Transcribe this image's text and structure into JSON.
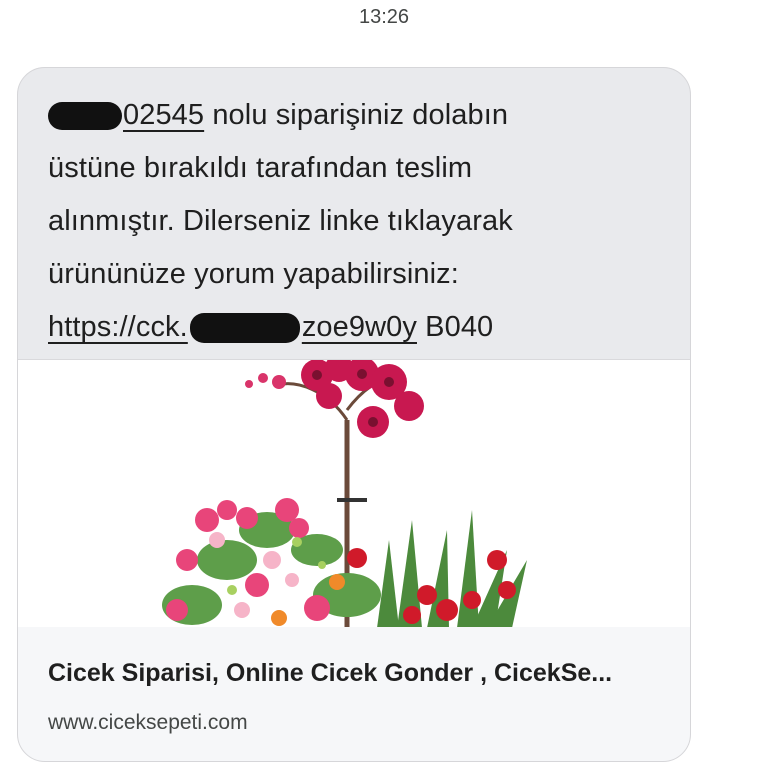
{
  "status": {
    "time": "13:26"
  },
  "message": {
    "line1_number_visible": "02545",
    "line1_rest": " nolu siparişiniz dolabın",
    "line2": "üstüne bırakıldı tarafından teslim",
    "line3": "alınmıştır. Dilerseniz linke tıklayarak",
    "line4": "ürününüze yorum yapabilirsiniz:",
    "link_start": "https://cck.",
    "link_end": "zoe9w0y",
    "code": " B040"
  },
  "preview": {
    "image_icon": "flower-arrangement-image",
    "title": "Cicek Siparisi, Online Cicek Gonder , CicekSe...",
    "url": "www.ciceksepeti.com"
  },
  "colors": {
    "bubble_bg": "#e9eaed",
    "card_bg": "#f6f7f9",
    "redaction": "#111111"
  }
}
